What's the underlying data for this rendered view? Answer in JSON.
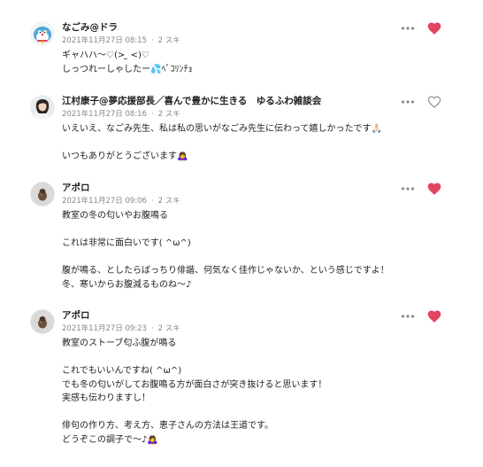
{
  "colors": {
    "liked": "#e2455f",
    "unliked": "#9a9a9a",
    "name": "#222222",
    "meta": "#888888"
  },
  "comments": [
    {
      "name": "なごみ@ドラ",
      "date": "2021年11月27日 08:15",
      "likes": "2 スキ",
      "liked": true,
      "avatar": "character-avatar",
      "lines": [
        "ギャハハ〜♡(> ̫ <)♡",
        "しっつれーしゃしたー💦ﾍﾟｺﾘﾝﾁｮ"
      ]
    },
    {
      "name": "江村康子@夢応援部長／喜んで豊かに生きる　ゆるふわ雑談会",
      "date": "2021年11月27日 08:16",
      "likes": "2 スキ",
      "liked": false,
      "avatar": "woman-avatar",
      "lines": [
        "いえいえ、なごみ先生、私は私の思いがなごみ先生に伝わって嬉しかったです🙏🏻",
        "",
        "いつもありがとうございます🙇‍♀️"
      ]
    },
    {
      "name": "アポロ",
      "date": "2021年11月27日 09:06",
      "likes": "2 スキ",
      "liked": true,
      "avatar": "apollo-avatar",
      "lines": [
        "教室の冬の匂いやお腹鳴る",
        "",
        "これは非常に面白いです( ^ω^)",
        "",
        "腹が鳴る、としたらばっちり俳諧、何気なく佳作じゃないか、という感じですよ！",
        "冬、寒いからお腹減るものね〜♪"
      ]
    },
    {
      "name": "アポロ",
      "date": "2021年11月27日 09:23",
      "likes": "2 スキ",
      "liked": true,
      "avatar": "apollo-avatar",
      "lines": [
        "教室のストーブ匂ふ腹が鳴る",
        "",
        "これでもいいんですね( ^ω^)",
        "でも冬の匂いがしてお腹鳴る方が面白さが突き抜けると思います！",
        "実感も伝わりますし！",
        "",
        "俳句の作り方、考え方、恵子さんの方法は王道です。",
        "どうぞこの調子で〜♪🙇‍♀️"
      ]
    }
  ]
}
